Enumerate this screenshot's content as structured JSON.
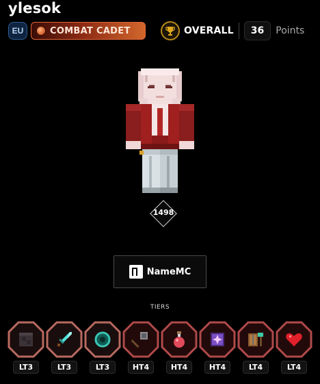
{
  "player": {
    "username": "ylesok",
    "region": "EU",
    "rank_title": "COMBAT CADET",
    "overall_label": "OVERALL",
    "points": "36",
    "points_label": "Points",
    "score": "1498"
  },
  "profile_link": {
    "label": "NameMC"
  },
  "tiers": {
    "title": "TIERS",
    "items": [
      {
        "icon": "netherite-block-icon",
        "label": "LT3",
        "ring_color": "#b86a60"
      },
      {
        "icon": "diamond-sword-icon",
        "label": "LT3",
        "ring_color": "#b86a60"
      },
      {
        "icon": "ender-pearl-icon",
        "label": "LT3",
        "ring_color": "#b86a60"
      },
      {
        "icon": "mace-icon",
        "label": "HT4",
        "ring_color": "#b04a4a"
      },
      {
        "icon": "potion-icon",
        "label": "HT4",
        "ring_color": "#b04a4a"
      },
      {
        "icon": "enchanted-book-icon",
        "label": "HT4",
        "ring_color": "#b04a4a"
      },
      {
        "icon": "shield-axe-icon",
        "label": "LT4",
        "ring_color": "#b04a4a"
      },
      {
        "icon": "heart-icon",
        "label": "LT4",
        "ring_color": "#b04a4a"
      }
    ]
  },
  "colors": {
    "background": "#000000",
    "rank_accent": "#e3643a",
    "trophy_gold": "#d9a21b",
    "region_blue": "#2f5e96"
  }
}
